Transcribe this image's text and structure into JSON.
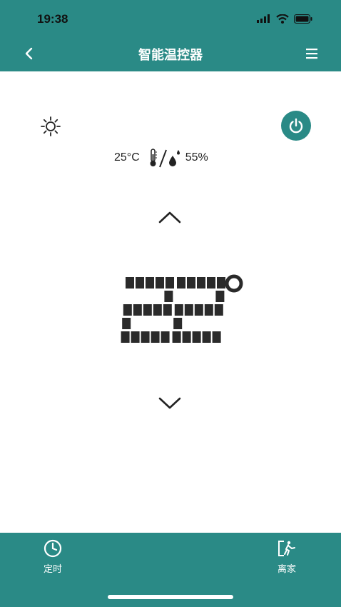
{
  "status_bar": {
    "time": "19:38",
    "icons": [
      "signal-icon",
      "wifi-icon",
      "battery-icon"
    ]
  },
  "nav": {
    "title": "智能温控器",
    "back_icon": "chevron-left-icon",
    "menu_icon": "hamburger-menu-icon"
  },
  "controls": {
    "mode_icon": "sun-icon",
    "power_icon": "power-icon"
  },
  "environment": {
    "temperature": "25°C",
    "humidity": "55%"
  },
  "setpoint": {
    "value": "22",
    "unit": "°",
    "up_icon": "chevron-up-icon",
    "down_icon": "chevron-down-icon"
  },
  "bottom_tabs": [
    {
      "label": "定时",
      "icon": "clock-icon"
    },
    {
      "label": "离家",
      "icon": "exit-door-icon"
    }
  ],
  "colors": {
    "brand": "#2a8a86",
    "segment": "#2a2a2a"
  }
}
